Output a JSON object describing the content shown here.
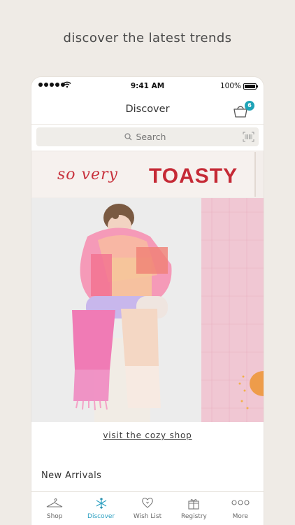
{
  "headline": "discover the latest trends",
  "status_bar": {
    "time": "9:41 AM",
    "battery": "100%"
  },
  "header": {
    "title": "Discover",
    "cart_count": "6"
  },
  "search": {
    "placeholder": "Search"
  },
  "banner": {
    "script_text": "so very",
    "bold_text": "TOASTY"
  },
  "cta": {
    "label": "visit the cozy shop"
  },
  "section": {
    "title": "New Arrivals"
  },
  "tabs": [
    {
      "label": "Shop",
      "icon": "hanger-icon"
    },
    {
      "label": "Discover",
      "icon": "snowflake-icon",
      "active": true
    },
    {
      "label": "Wish List",
      "icon": "heart-icon"
    },
    {
      "label": "Registry",
      "icon": "gift-icon"
    },
    {
      "label": "More",
      "icon": "more-icon"
    }
  ],
  "colors": {
    "accent": "#2a9fc1",
    "badge": "#1fa3b7",
    "banner_red": "#c52a36",
    "hero_pink": "#f0c7d3"
  }
}
